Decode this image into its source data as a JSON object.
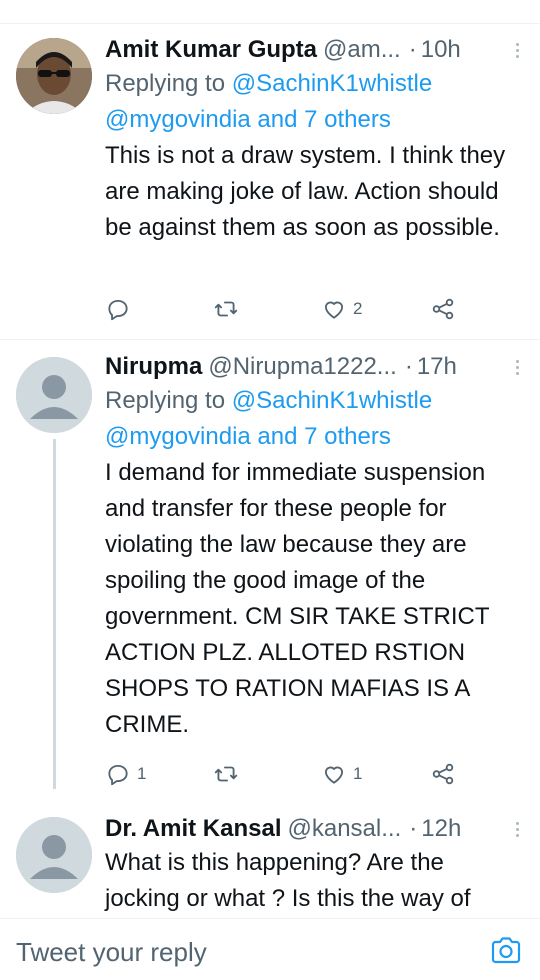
{
  "tweets": [
    {
      "name": "Amit Kumar Gupta",
      "handle": "@am...",
      "sep": "·",
      "time": "10h",
      "replying_prefix": "Replying to ",
      "replying_to": "@SachinK1whistle",
      "replying_more": "@mygovindia and 7 others",
      "body": "This is not a draw system. I think they are making joke of law. Action should be against them as soon as possible.",
      "replies": "",
      "likes": "2"
    },
    {
      "name": "Nirupma",
      "handle": "@Nirupma1222...",
      "sep": "·",
      "time": "17h",
      "replying_prefix": "Replying to ",
      "replying_to": "@SachinK1whistle",
      "replying_more": "@mygovindia and 7 others",
      "body": "I demand for immediate suspension and transfer for these people for violating the law because they are spoiling the good image of the government. CM SIR TAKE STRICT ACTION PLZ. ALLOTED RSTION SHOPS TO RATION MAFIAS IS A CRIME.",
      "replies": "1",
      "likes": "1"
    },
    {
      "name": "Dr. Amit Kansal",
      "handle": "@kansal...",
      "sep": "·",
      "time": "12h",
      "body": "What is this happening? Are the jocking or what ? Is this the way of"
    }
  ],
  "reply_bar": {
    "placeholder": "Tweet your reply"
  },
  "colors": {
    "link": "#1d9bf0",
    "secondary_text": "#536471",
    "divider": "#eff3f4"
  }
}
